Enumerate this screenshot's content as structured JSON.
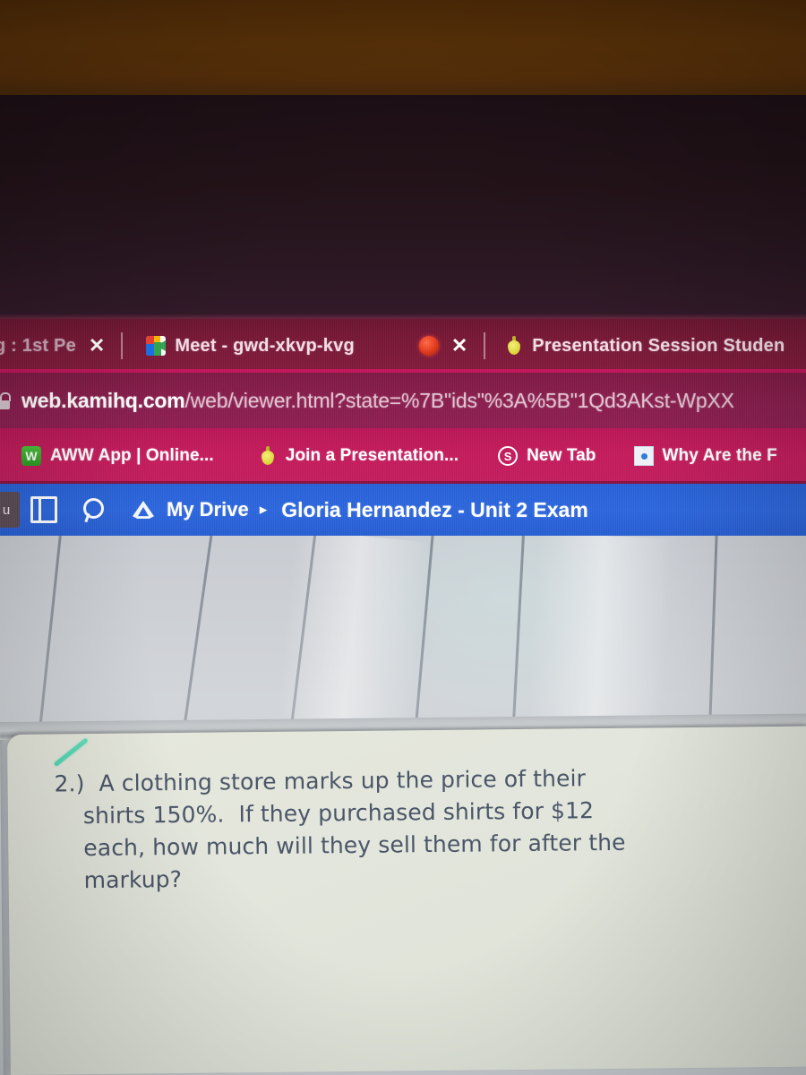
{
  "browser": {
    "tabs": [
      {
        "title": "g : 1st Pe",
        "favicon": "none",
        "truncated": true,
        "close_label": "✕"
      },
      {
        "title": "Meet - gwd-xkvp-kvg",
        "favicon": "google-meet-icon",
        "close_label": "✕",
        "status_icon": "recording-dot-icon"
      },
      {
        "title": "Presentation Session Studen",
        "favicon": "pear-deck-icon",
        "truncated": true
      }
    ],
    "omnibox": {
      "security_icon": "lock-icon",
      "url_host": "web.kamihq.com",
      "url_path": "/web/viewer.html?state=%7B\"ids\"%3A%5B\"1Qd3AKst-WpXX",
      "url_full": "web.kamihq.com/web/viewer.html?state=%7B\"ids\"%3A%5B\"1Qd3AKst-WpXX"
    },
    "bookmarks": [
      {
        "label": "AWW App | Online...",
        "icon": "aww-app-icon"
      },
      {
        "label": "Join a Presentation...",
        "icon": "pear-deck-icon"
      },
      {
        "label": "New Tab",
        "icon": "swirl-icon"
      },
      {
        "label": "Why Are the F",
        "icon": "page-icon",
        "truncated": true
      }
    ]
  },
  "kami_toolbar": {
    "left_stub_label": "u",
    "panel_icon": "sidebar-panel-icon",
    "search_icon": "search-icon",
    "drive_icon": "google-drive-icon",
    "drive_label": "My Drive",
    "caret": "▸",
    "document_title": "Gloria Hernandez - Unit 2 Exam"
  },
  "document": {
    "question_number": "2.)",
    "lines": [
      "2.)  A clothing store marks up the price of their",
      "shirts 150%.  If they purchased shirts for $12",
      "each, how much will they sell them for after the",
      "markup?"
    ],
    "annotation": "green-highlight-slash"
  },
  "colors": {
    "tab_strip": "#7a1b3a",
    "omnibox": "#8b2050",
    "bookmarks_bar": "#c41e5e",
    "kami_toolbar": "#2f68dd",
    "accent_stripe": "#c2185b",
    "page_background": "#e3e6dc",
    "highlight_green": "#49d6b0",
    "bezel_brown": "#5a3209",
    "bezel_dark": "#231319"
  }
}
